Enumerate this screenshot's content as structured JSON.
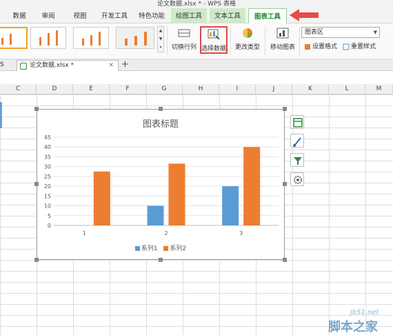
{
  "window": {
    "title": "论文数据.xlsx * - WPS 表格"
  },
  "ribbon_tabs": [
    "数据",
    "审阅",
    "视图",
    "开发工具",
    "特色功能",
    "绘图工具",
    "文本工具",
    "图表工具"
  ],
  "ribbon": {
    "switch_row_col": "切换行列",
    "select_data": "选择数据",
    "change_type": "更改类型",
    "move_chart": "移动图表",
    "area_dropdown": "图表区",
    "set_format": "设置格式",
    "reset_style": "重置样式"
  },
  "doc_tabs": {
    "prev_partial": "S",
    "current": "论文数据.xlsx *",
    "new_tab": "+"
  },
  "columns": [
    "C",
    "D",
    "E",
    "F",
    "G",
    "H",
    "I",
    "J",
    "K",
    "L",
    "M"
  ],
  "colors": {
    "series1": "#5b9bd5",
    "series2": "#ed7d31",
    "active_tab": "#1f8a2d",
    "highlight": "#e04545"
  },
  "chart_data": {
    "type": "bar",
    "title": "图表标题",
    "categories": [
      "1",
      "2",
      "3"
    ],
    "series": [
      {
        "name": "系列1",
        "values": [
          0,
          10,
          20
        ]
      },
      {
        "name": "系列2",
        "values": [
          27.5,
          31.5,
          40
        ]
      }
    ],
    "ylim": [
      0,
      45
    ],
    "yticks": [
      "0",
      "5",
      "10",
      "15",
      "20",
      "25",
      "30",
      "35",
      "40",
      "45"
    ],
    "grid": true,
    "legend": "bottom"
  },
  "watermark": {
    "site": "jb51.net",
    "name": "脚本之家"
  }
}
